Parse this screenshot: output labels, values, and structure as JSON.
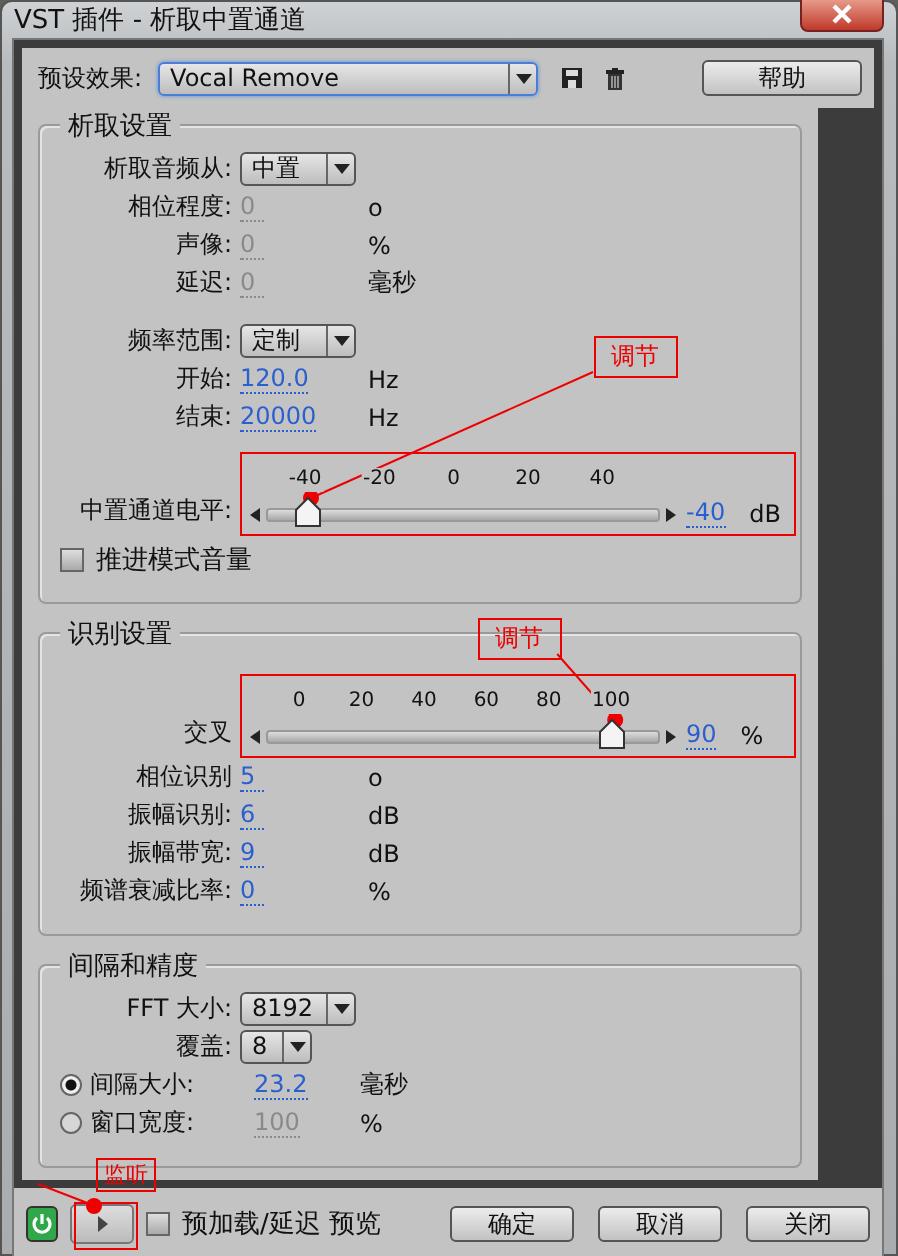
{
  "window": {
    "title": "VST 插件 - 析取中置通道"
  },
  "preset": {
    "label": "预设效果:",
    "value": "Vocal Remove"
  },
  "help_button": "帮助",
  "groups": [
    {
      "title": "析取设置",
      "rows": [
        {
          "kind": "dropdown",
          "label": "析取音频从:",
          "value": "中置"
        },
        {
          "kind": "number",
          "label": "相位程度:",
          "value": "0",
          "unit": "o",
          "disabled": true
        },
        {
          "kind": "number",
          "label": "声像:",
          "value": "0",
          "unit": "%",
          "disabled": true
        },
        {
          "kind": "number",
          "label": "延迟:",
          "value": "0",
          "unit": "毫秒",
          "disabled": true
        },
        {
          "kind": "dropdown",
          "label": "频率范围:",
          "value": "定制"
        },
        {
          "kind": "number",
          "label": "开始:",
          "value": "120.0",
          "unit": "Hz",
          "disabled": false
        },
        {
          "kind": "number",
          "label": "结束:",
          "value": "20000",
          "unit": "Hz",
          "disabled": false
        },
        {
          "kind": "slider",
          "label": "中置通道电平:",
          "ticks": [
            "-40",
            "-20",
            "0",
            "20",
            "40"
          ],
          "level": 0.1,
          "value": "-40",
          "unit": "dB",
          "annotation": "调节"
        },
        {
          "kind": "checkbox",
          "label": "推进模式音量",
          "checked": false
        }
      ]
    },
    {
      "title": "识别设置",
      "rows": [
        {
          "kind": "slider",
          "label": "交叉",
          "ticks": [
            "0",
            "20",
            "40",
            "60",
            "80",
            "100"
          ],
          "level": 0.88,
          "value": "90",
          "unit": "%",
          "annotation": "调节"
        },
        {
          "kind": "number",
          "label": "相位识别",
          "value": "5",
          "unit": "o",
          "disabled": false
        },
        {
          "kind": "number",
          "label": "振幅识别:",
          "value": "6",
          "unit": "dB",
          "disabled": false
        },
        {
          "kind": "number",
          "label": "振幅带宽:",
          "value": "9",
          "unit": "dB",
          "disabled": false
        },
        {
          "kind": "number",
          "label": "频谱衰减比率:",
          "value": "0",
          "unit": "%",
          "disabled": false
        }
      ]
    },
    {
      "title": "间隔和精度",
      "rows": [
        {
          "kind": "dropdown",
          "label": "FFT 大小:",
          "value": "8192"
        },
        {
          "kind": "dropdown",
          "label": "覆盖:",
          "value": "8"
        },
        {
          "kind": "radio",
          "label": "间隔大小:",
          "value": "23.2",
          "unit": "毫秒",
          "selected": true
        },
        {
          "kind": "radio",
          "label": "窗口宽度:",
          "value": "100",
          "unit": "%",
          "selected": false
        }
      ]
    }
  ],
  "bottom": {
    "power_on": true,
    "play_annotation": "监听",
    "preview": {
      "label": "预加载/延迟 预览",
      "checked": false
    },
    "buttons": [
      "确定",
      "取消",
      "关闭"
    ]
  }
}
